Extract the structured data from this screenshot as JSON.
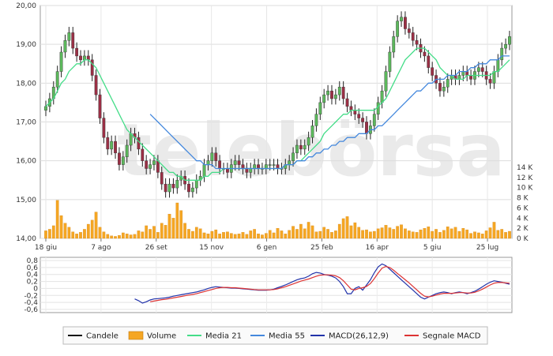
{
  "watermark": "telebörsa",
  "chart_data": [
    {
      "type": "candlestick",
      "title": "",
      "x_labels": [
        "18 giu",
        "7 ago",
        "26 set",
        "15 nov",
        "6 gen",
        "25 feb",
        "16 apr",
        "5 giu",
        "25 lug"
      ],
      "y_ticks": [
        "20,00",
        "19,00",
        "18,00",
        "17,00",
        "16,00",
        "15,00",
        "14,00"
      ],
      "ylim": [
        14,
        20
      ],
      "grid": true,
      "colors": {
        "up": "#5cb85c",
        "down": "#9b2f45"
      },
      "close": [
        17.4,
        17.6,
        17.9,
        18.3,
        18.8,
        19.1,
        19.3,
        18.9,
        18.7,
        18.6,
        18.7,
        18.6,
        18.2,
        17.7,
        17.1,
        16.6,
        16.3,
        16.5,
        16.2,
        15.9,
        16.1,
        16.4,
        16.7,
        16.6,
        16.3,
        16.0,
        15.8,
        15.9,
        16.0,
        15.7,
        15.4,
        15.2,
        15.4,
        15.3,
        15.5,
        15.6,
        15.4,
        15.2,
        15.3,
        15.5,
        15.6,
        15.9,
        16.0,
        16.2,
        16.0,
        15.8,
        15.8,
        15.7,
        15.9,
        16.0,
        15.9,
        15.8,
        15.7,
        15.8,
        15.9,
        15.8,
        15.8,
        15.9,
        15.9,
        15.9,
        15.8,
        15.8,
        15.9,
        16.0,
        16.2,
        16.4,
        16.3,
        16.4,
        16.6,
        16.9,
        17.2,
        17.5,
        17.7,
        17.8,
        17.6,
        17.7,
        17.9,
        17.6,
        17.4,
        17.3,
        17.2,
        17.1,
        17.0,
        16.7,
        16.9,
        17.2,
        17.5,
        17.8,
        18.3,
        18.8,
        19.2,
        19.6,
        19.7,
        19.4,
        19.3,
        19.1,
        19.0,
        18.8,
        18.7,
        18.4,
        18.2,
        18.0,
        17.8,
        17.9,
        18.1,
        18.2,
        18.1,
        18.2,
        18.3,
        18.2,
        18.1,
        18.3,
        18.4,
        18.3,
        18.1,
        18.0,
        18.3,
        18.6,
        18.9,
        19.0,
        19.2
      ],
      "series": [
        {
          "name": "Media 21",
          "color": "#44dd88",
          "values": [
            17.4,
            17.5,
            17.6,
            17.8,
            18.0,
            18.1,
            18.3,
            18.4,
            18.5,
            18.5,
            18.6,
            18.6,
            18.5,
            18.4,
            18.2,
            18.0,
            17.8,
            17.6,
            17.4,
            17.2,
            17.0,
            16.8,
            16.7,
            16.6,
            16.5,
            16.4,
            16.3,
            16.2,
            16.1,
            16.0,
            15.9,
            15.8,
            15.7,
            15.7,
            15.6,
            15.6,
            15.5,
            15.5,
            15.5,
            15.5,
            15.5,
            15.6,
            15.6,
            15.7,
            15.7,
            15.7,
            15.8,
            15.8,
            15.8,
            15.8,
            15.8,
            15.8,
            15.8,
            15.8,
            15.8,
            15.8,
            15.8,
            15.8,
            15.8,
            15.8,
            15.8,
            15.8,
            15.9,
            15.9,
            15.9,
            16.0,
            16.0,
            16.1,
            16.2,
            16.3,
            16.4,
            16.5,
            16.7,
            16.8,
            16.9,
            17.0,
            17.1,
            17.2,
            17.2,
            17.3,
            17.3,
            17.3,
            17.3,
            17.3,
            17.3,
            17.3,
            17.4,
            17.5,
            17.6,
            17.8,
            18.0,
            18.2,
            18.4,
            18.6,
            18.7,
            18.8,
            18.9,
            18.9,
            18.9,
            18.8,
            18.7,
            18.6,
            18.4,
            18.3,
            18.2,
            18.2,
            18.1,
            18.1,
            18.1,
            18.2,
            18.2,
            18.2,
            18.2,
            18.2,
            18.2,
            18.2,
            18.3,
            18.3,
            18.4,
            18.5,
            18.6
          ]
        },
        {
          "name": "Media 55",
          "color": "#4488dd",
          "values": [
            null,
            null,
            null,
            null,
            null,
            null,
            null,
            null,
            null,
            null,
            null,
            null,
            null,
            null,
            null,
            null,
            null,
            null,
            null,
            null,
            null,
            null,
            null,
            null,
            null,
            null,
            null,
            17.2,
            17.1,
            17.0,
            16.9,
            16.8,
            16.7,
            16.6,
            16.5,
            16.4,
            16.3,
            16.2,
            16.1,
            16.0,
            16.0,
            15.9,
            15.9,
            15.9,
            15.8,
            15.8,
            15.8,
            15.8,
            15.8,
            15.8,
            15.8,
            15.8,
            15.8,
            15.8,
            15.8,
            15.8,
            15.8,
            15.8,
            15.8,
            15.8,
            15.8,
            15.8,
            15.9,
            15.9,
            15.9,
            16.0,
            16.0,
            16.0,
            16.1,
            16.1,
            16.2,
            16.2,
            16.3,
            16.3,
            16.4,
            16.4,
            16.5,
            16.5,
            16.6,
            16.6,
            16.6,
            16.7,
            16.7,
            16.7,
            16.8,
            16.8,
            16.9,
            16.9,
            17.0,
            17.1,
            17.2,
            17.3,
            17.4,
            17.5,
            17.6,
            17.7,
            17.8,
            17.8,
            17.9,
            18.0,
            18.0,
            18.1,
            18.1,
            18.1,
            18.2,
            18.2,
            18.2,
            18.3,
            18.3,
            18.3,
            18.4,
            18.4,
            18.5,
            18.5,
            18.5,
            18.6,
            18.6,
            18.6,
            18.7,
            18.7,
            18.7
          ]
        }
      ]
    },
    {
      "type": "bar",
      "title": "",
      "y_ticks": [
        "14 K",
        "12 K",
        "10 K",
        "8 K",
        "6 K",
        "4 K",
        "2 K",
        "0 K"
      ],
      "ylim": [
        0,
        14000
      ],
      "color": "#f5a623",
      "values": [
        1500,
        1800,
        2500,
        7500,
        4500,
        3000,
        2200,
        1300,
        900,
        1200,
        1800,
        2800,
        3600,
        5200,
        2200,
        1300,
        800,
        500,
        400,
        600,
        1100,
        900,
        700,
        800,
        1500,
        1300,
        2500,
        1800,
        2400,
        1200,
        3000,
        2600,
        4800,
        4000,
        7000,
        5500,
        3000,
        1800,
        1400,
        2200,
        1900,
        1100,
        900,
        1400,
        1700,
        900,
        1200,
        1300,
        1000,
        800,
        900,
        1200,
        800,
        1500,
        1800,
        900,
        700,
        1000,
        1600,
        1100,
        2000,
        1500,
        900,
        1600,
        2400,
        1800,
        2800,
        1900,
        3200,
        2500,
        1300,
        1400,
        2200,
        1800,
        1200,
        1500,
        2800,
        3900,
        4300,
        2500,
        3100,
        2200,
        1600,
        1700,
        1300,
        1400,
        1900,
        2100,
        2600,
        2100,
        1800,
        2400,
        2700,
        1900,
        1500,
        1300,
        1200,
        1700,
        2000,
        2300,
        1400,
        1800,
        1200,
        1600,
        2300,
        1900,
        2200,
        1400,
        2000,
        1700,
        1000,
        1300,
        1100,
        900,
        1500,
        2100,
        3200,
        1600,
        1800,
        1200,
        1400
      ]
    },
    {
      "type": "line",
      "title": "",
      "y_ticks": [
        "0,8",
        "0,6",
        "0,4",
        "0,2",
        "0",
        "-0,2",
        "-0,4",
        "-0,6"
      ],
      "ylim": [
        -0.6,
        0.8
      ],
      "grid": true,
      "series": [
        {
          "name": "MACD(26,12,9)",
          "color": "#2233aa",
          "values": [
            null,
            null,
            null,
            null,
            null,
            null,
            null,
            null,
            null,
            null,
            null,
            null,
            null,
            null,
            null,
            null,
            null,
            null,
            null,
            null,
            null,
            null,
            null,
            -0.3,
            -0.35,
            -0.42,
            -0.38,
            -0.33,
            -0.3,
            -0.29,
            -0.28,
            -0.27,
            -0.25,
            -0.22,
            -0.2,
            -0.18,
            -0.16,
            -0.14,
            -0.12,
            -0.1,
            -0.07,
            -0.04,
            0.0,
            0.03,
            0.05,
            0.04,
            0.03,
            0.02,
            0.01,
            0.01,
            0.0,
            -0.01,
            -0.02,
            -0.03,
            -0.04,
            -0.05,
            -0.05,
            -0.05,
            -0.04,
            -0.02,
            0.02,
            0.06,
            0.1,
            0.15,
            0.2,
            0.25,
            0.28,
            0.3,
            0.35,
            0.42,
            0.46,
            0.44,
            0.4,
            0.38,
            0.35,
            0.3,
            0.2,
            0.05,
            -0.15,
            -0.15,
            0.0,
            0.05,
            -0.05,
            0.1,
            0.25,
            0.45,
            0.62,
            0.7,
            0.65,
            0.55,
            0.45,
            0.35,
            0.25,
            0.15,
            0.05,
            -0.05,
            -0.15,
            -0.25,
            -0.3,
            -0.25,
            -0.2,
            -0.15,
            -0.12,
            -0.1,
            -0.12,
            -0.15,
            -0.12,
            -0.1,
            -0.12,
            -0.15,
            -0.12,
            -0.08,
            -0.02,
            0.05,
            0.12,
            0.18,
            0.22,
            0.2,
            0.18,
            0.15,
            0.12
          ]
        },
        {
          "name": "Segnale MACD",
          "color": "#dd3333",
          "values": [
            null,
            null,
            null,
            null,
            null,
            null,
            null,
            null,
            null,
            null,
            null,
            null,
            null,
            null,
            null,
            null,
            null,
            null,
            null,
            null,
            null,
            null,
            null,
            null,
            null,
            null,
            null,
            -0.38,
            -0.36,
            -0.34,
            -0.32,
            -0.31,
            -0.29,
            -0.27,
            -0.25,
            -0.23,
            -0.21,
            -0.19,
            -0.17,
            -0.15,
            -0.12,
            -0.09,
            -0.06,
            -0.03,
            0.0,
            0.02,
            0.03,
            0.03,
            0.02,
            0.02,
            0.01,
            0.0,
            -0.01,
            -0.02,
            -0.03,
            -0.04,
            -0.04,
            -0.04,
            -0.04,
            -0.03,
            -0.01,
            0.02,
            0.05,
            0.09,
            0.13,
            0.17,
            0.21,
            0.24,
            0.27,
            0.31,
            0.35,
            0.38,
            0.39,
            0.39,
            0.38,
            0.36,
            0.31,
            0.22,
            0.1,
            -0.02,
            -0.04,
            0.0,
            0.02,
            0.06,
            0.14,
            0.28,
            0.44,
            0.58,
            0.63,
            0.6,
            0.52,
            0.43,
            0.34,
            0.25,
            0.16,
            0.06,
            -0.04,
            -0.14,
            -0.22,
            -0.24,
            -0.22,
            -0.19,
            -0.16,
            -0.14,
            -0.14,
            -0.14,
            -0.13,
            -0.12,
            -0.12,
            -0.13,
            -0.13,
            -0.11,
            -0.07,
            -0.02,
            0.04,
            0.1,
            0.15,
            0.17,
            0.17,
            0.16,
            0.15
          ]
        }
      ]
    }
  ],
  "legend": [
    {
      "label": "Candele",
      "kind": "line",
      "color": "#111111"
    },
    {
      "label": "Volume",
      "kind": "box",
      "color": "#f5a623"
    },
    {
      "label": "Media 21",
      "kind": "line",
      "color": "#44dd88"
    },
    {
      "label": "Media 55",
      "kind": "line",
      "color": "#4488dd"
    },
    {
      "label": "MACD(26,12,9)",
      "kind": "line",
      "color": "#2233aa"
    },
    {
      "label": "Segnale MACD",
      "kind": "line",
      "color": "#dd3333"
    }
  ]
}
